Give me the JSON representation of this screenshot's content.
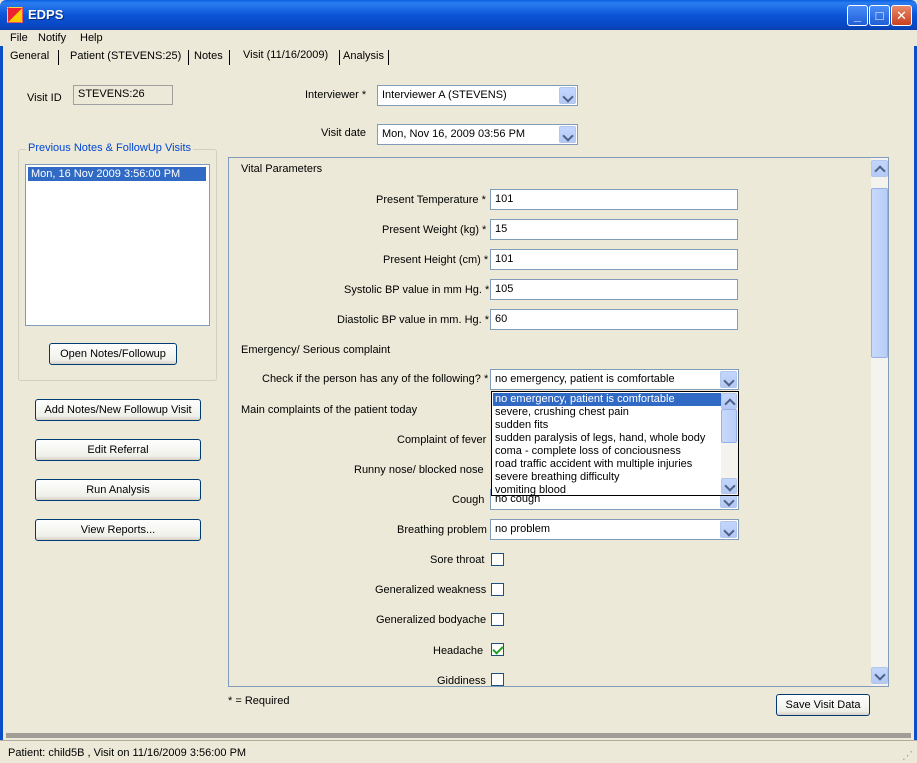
{
  "window": {
    "title": "EDPS"
  },
  "menu": [
    "File",
    "Notify",
    "Help"
  ],
  "tabs": [
    "General",
    "Patient (STEVENS:25)",
    "Notes",
    "Visit (11/16/2009)",
    "Analysis"
  ],
  "visit": {
    "id_label": "Visit ID",
    "id_value": "STEVENS:26",
    "interviewer_label": "Interviewer *",
    "interviewer_value": "Interviewer A  (STEVENS)",
    "date_label": "Visit date",
    "date_value": "Mon, Nov 16, 2009  03:56 PM"
  },
  "previous": {
    "title": "Previous Notes & FollowUp Visits",
    "items": [
      "Mon, 16 Nov 2009 3:56:00 PM"
    ],
    "open_button": "Open Notes/Followup"
  },
  "actions": {
    "add": "Add Notes/New Followup Visit",
    "edit": "Edit Referral",
    "run": "Run Analysis",
    "reports": "View Reports..."
  },
  "vitals": {
    "section": "Vital Parameters",
    "temperature_label": "Present Temperature *",
    "temperature_value": "101",
    "weight_label": "Present Weight (kg) *",
    "weight_value": "15",
    "height_label": "Present Height (cm) *",
    "height_value": "101",
    "systolic_label": "Systolic BP value in mm Hg. *",
    "systolic_value": "105",
    "diastolic_label": "Diastolic BP value in mm. Hg. *",
    "diastolic_value": "60"
  },
  "emergency": {
    "section": "Emergency/ Serious complaint",
    "check_label": "Check if the person has any of the following? *",
    "check_value": "no emergency, patient is comfortable",
    "options": [
      "no emergency, patient is comfortable",
      "severe, crushing chest pain",
      "sudden fits",
      "sudden paralysis of legs, hand, whole body",
      "coma - complete loss of conciousness",
      "road traffic accident with multiple injuries",
      "severe breathing difficulty",
      "vomiting blood"
    ]
  },
  "complaints": {
    "section": "Main complaints of the patient today",
    "fever_label": "Complaint of fever",
    "runny_label": "Runny nose/ blocked nose",
    "cough_label": "Cough",
    "cough_value": "no cough",
    "breathing_label": "Breathing problem",
    "breathing_value": "no problem",
    "sore_throat_label": "Sore throat",
    "weakness_label": "Generalized weakness",
    "bodyache_label": "Generalized bodyache",
    "headache_label": "Headache",
    "giddiness_label": "Giddiness"
  },
  "footer": {
    "required_note": "* = Required",
    "save_button": "Save Visit Data"
  },
  "status": {
    "text": "Patient: child5B , Visit on 11/16/2009 3:56:00 PM"
  }
}
